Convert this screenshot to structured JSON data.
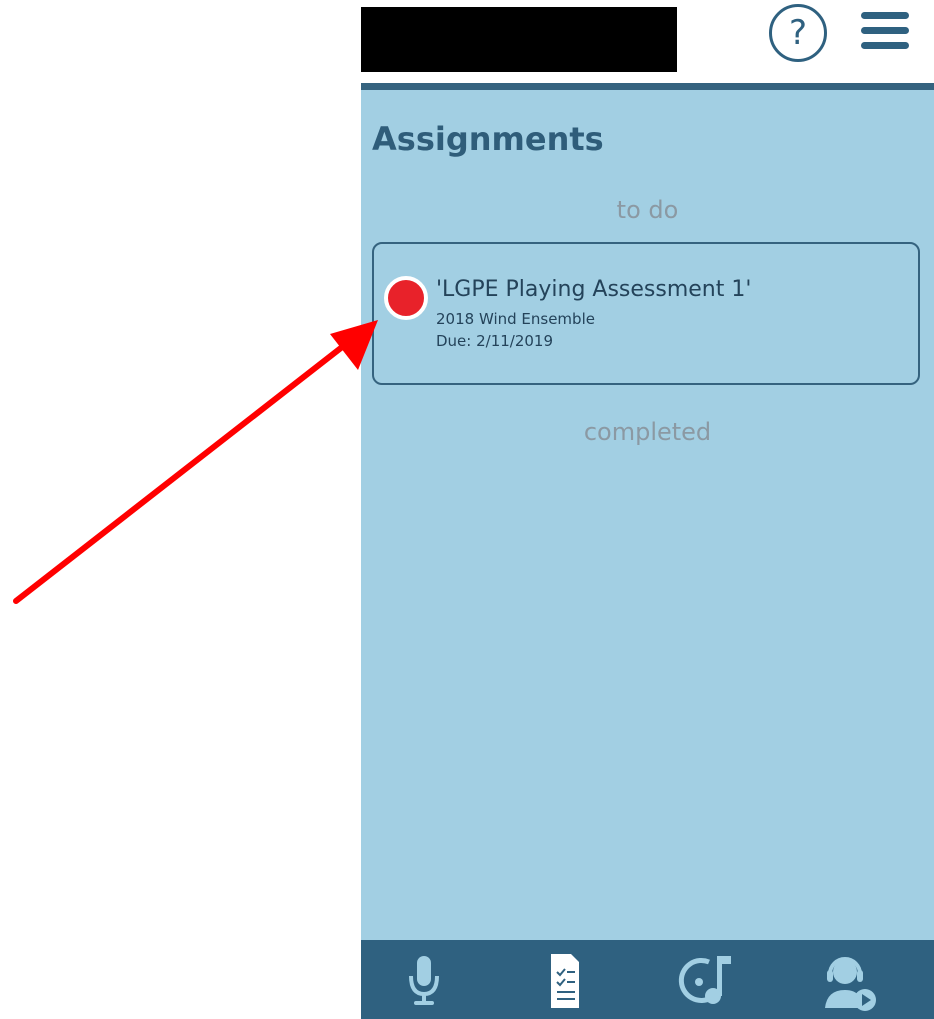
{
  "header": {
    "help_glyph": "?",
    "help_icon": "help-circle-icon",
    "menu_icon": "hamburger-menu-icon"
  },
  "main": {
    "title": "Assignments",
    "sections": {
      "todo_label": "to do",
      "completed_label": "completed"
    },
    "assignments": [
      {
        "title": "'LGPE Playing Assessment 1'",
        "group": "2018 Wind Ensemble",
        "due": "Due: 2/11/2019",
        "status_color": "#e8222a"
      }
    ]
  },
  "bottom_nav": {
    "items": [
      {
        "icon": "microphone-icon"
      },
      {
        "icon": "assignment-list-icon"
      },
      {
        "icon": "music-record-icon"
      },
      {
        "icon": "support-agent-icon"
      }
    ]
  },
  "colors": {
    "background": "#a2cfe3",
    "primary": "#2f6180",
    "title": "#2f5d7a",
    "annotation_arrow": "#ff0000"
  }
}
